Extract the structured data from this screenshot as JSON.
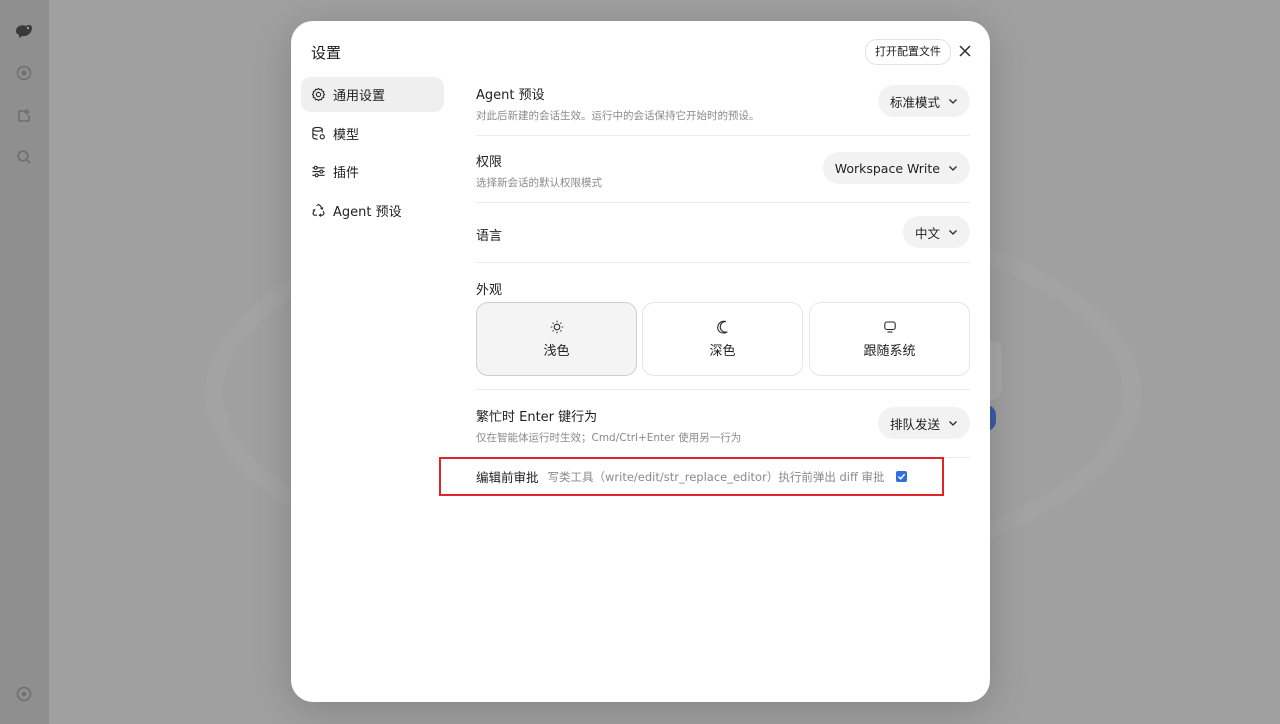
{
  "dialog": {
    "title": "设置",
    "open_config_label": "打开配置文件"
  },
  "nav": {
    "items": [
      {
        "label": "通用设置",
        "icon": "gear-icon",
        "active": true
      },
      {
        "label": "模型",
        "icon": "database-icon",
        "active": false
      },
      {
        "label": "插件",
        "icon": "sliders-icon",
        "active": false
      },
      {
        "label": "Agent 预设",
        "icon": "recycle-icon",
        "active": false
      }
    ]
  },
  "settings": {
    "agent_preset": {
      "title": "Agent 预设",
      "description": "对此后新建的会话生效。运行中的会话保持它开始时的预设。",
      "value": "标准模式"
    },
    "permission": {
      "title": "权限",
      "description": "选择新会话的默认权限模式",
      "value": "Workspace Write"
    },
    "language": {
      "title": "语言",
      "value": "中文"
    },
    "appearance": {
      "title": "外观",
      "options": [
        {
          "label": "浅色",
          "icon": "sun-icon",
          "selected": true
        },
        {
          "label": "深色",
          "icon": "moon-icon",
          "selected": false
        },
        {
          "label": "跟随系统",
          "icon": "monitor-icon",
          "selected": false
        }
      ]
    },
    "busy_enter": {
      "title": "繁忙时 Enter 键行为",
      "description": "仅在智能体运行时生效；Cmd/Ctrl+Enter 使用另一行为",
      "value": "排队发送"
    },
    "edit_approval": {
      "title": "编辑前审批",
      "description": "写类工具（write/edit/str_replace_editor）执行前弹出 diff 审批",
      "checked": true
    }
  },
  "colors": {
    "accent": "#2f6fe0",
    "highlight_border": "#e0242a"
  }
}
